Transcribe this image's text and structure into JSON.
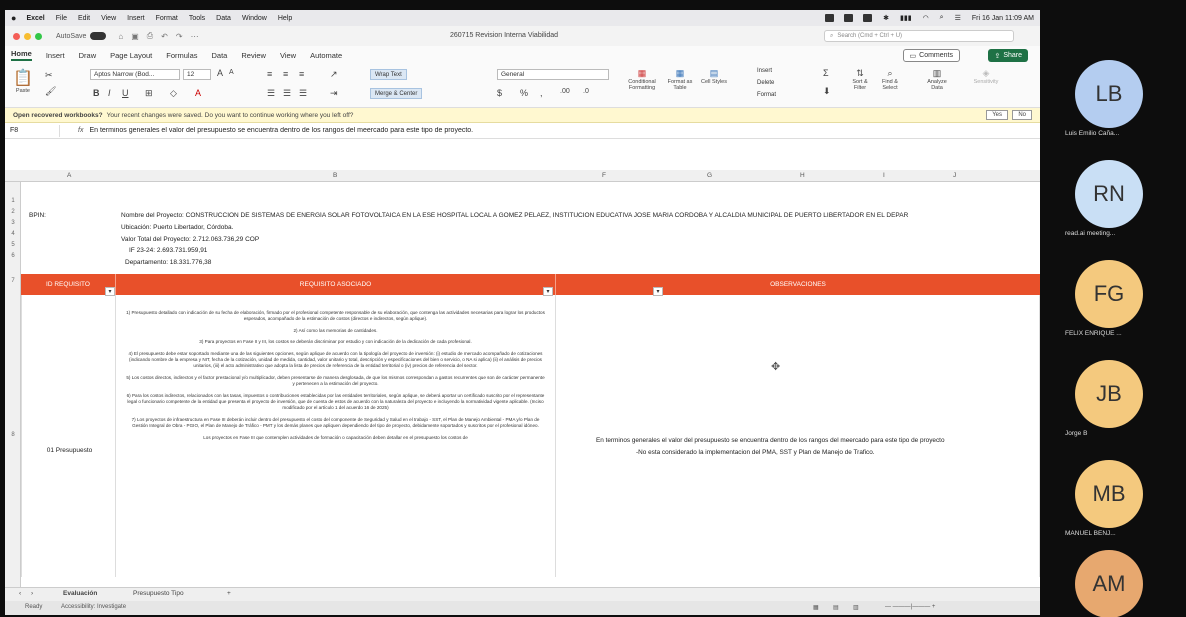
{
  "menubar": {
    "items": [
      "Excel",
      "File",
      "Edit",
      "View",
      "Insert",
      "Format",
      "Tools",
      "Data",
      "Window",
      "Help"
    ],
    "datetime": "Fri 16 Jan 11:09 AM"
  },
  "titlebar": {
    "autosave": "AutoSave",
    "title": "260715 Revision Interna Viabilidad",
    "search_placeholder": "Search (Cmd + Ctrl + U)"
  },
  "ribbon": {
    "tabs": [
      "Home",
      "Insert",
      "Draw",
      "Page Layout",
      "Formulas",
      "Data",
      "Review",
      "View",
      "Automate"
    ],
    "comments": "Comments",
    "share": "Share",
    "font_name": "Aptos Narrow (Bod...",
    "font_size": "12",
    "wrap_text": "Wrap Text",
    "merge_center": "Merge & Center",
    "number_format": "General",
    "paste": "Paste",
    "conditional_formatting": "Conditional Formatting",
    "format_as_table": "Format as Table",
    "cell_styles": "Cell Styles",
    "insert": "Insert",
    "delete": "Delete",
    "format": "Format",
    "sort_filter": "Sort & Filter",
    "find_select": "Find & Select",
    "analyze_data": "Analyze Data",
    "sensitivity": "Sensitivity"
  },
  "notification": {
    "title": "Open recovered workbooks?",
    "message": "Your recent changes were saved. Do you want to continue working where you left off?",
    "yes": "Yes",
    "no": "No"
  },
  "formula_bar": {
    "cell": "F8",
    "fx": "fx",
    "content": "En terminos generales el valor del presupuesto se encuentra dentro de los rangos del meercado para este tipo de proyecto."
  },
  "columns": [
    "A",
    "B",
    "F",
    "G",
    "H",
    "I",
    "J"
  ],
  "rows": [
    "1",
    "2",
    "3",
    "4",
    "5",
    "6",
    "7",
    "8"
  ],
  "sheet": {
    "bpin_label": "BPIN:",
    "project_name": "Nombre del Proyecto: CONSTRUCCIÓN DE SISTEMAS DE ENERGÍA SOLAR FOTOVOLTAICA EN LA ESE HOSPITAL LOCAL A GOMEZ PELAEZ, INSTITUCION EDUCATIVA JOSE MARIA CORDOBA Y ALCALDIA MUNICIPAL DE PUERTO LIBERTADOR EN EL DEPAR",
    "location": "Ubicación: Puerto Libertador, Córdoba.",
    "total_value": "Valor Total del Proyecto: 2.712.063.736,29 COP",
    "if_value": "IF 23-24: 2.693.731.959,91",
    "department_value": "Departamento: 18.331.776,38",
    "headers": {
      "id": "ID REQUISITO",
      "req": "REQUISITO ASOCIADO",
      "obs": "OBSERVACIONES"
    },
    "requirement_id": "01 Presupuesto",
    "requirement_paragraphs": [
      "1) Presupuesto detallado con indicación de su fecha de elaboración, firmado por el profesional competente responsable de su elaboración, que contenga las actividades necesarias para lograr los productos esperados, acompañado de la estimación de costos (directos e indirectos, según aplique).",
      "2) Así como las memorias de cantidades.",
      "3) Para proyectos en Fase II y III, los costos se deberán discriminar por estudio y con indicación de la dedicación de cada profesional.",
      "4) El presupuesto debe estar soportado mediante una de las siguientes opciones, según aplique de acuerdo con la tipología del proyecto de inversión: (i) estudio de mercado acompañado de cotizaciones (indicando nombre de la empresa y NIT, fecha de la cotización, unidad de medida, cantidad, valor unitario y total, descripción y especificaciones del bien o servicio, o NA si aplica) (ii) el análisis de precios unitarios, (iii) el acto administrativo que adopta la lista de precios de referencia de la entidad territorial o (iv) precios de referencia del sector.",
      "5) Los costos directos, indirectos y el factor prestacional y/o multiplicador, deben presentarse de manera desglosada, de que los mismos correspondan a gastos recurrentes que son de carácter permanente y pertenecen a la estimación del proyecto.",
      "6) Para los costos indirectos, relacionados con las tasas, impuestos o contribuciones establecidas por las entidades territoriales, según aplique, se deberá aportar un certificado suscrito por el representante legal o funcionario competente de la entidad que presenta el proyecto de inversión, que de cuenta de estos de acuerdo con la naturaleza del proyecto e incluyendo la normatividad vigente aplicable. (Inciso modificado por el artículo 1 del acuerdo 16 de 2025)",
      "7) Los proyectos de infraestructura en Fase III deberán incluir dentro del presupuesto el costo del componente de Seguridad y Salud en el trabajo - SST, el Plan de Manejo Ambiental - PMA y/o Plan de Gestión Integral de Obra - PGIO, el Plan de Manejo de Tráfico - PMT y los demás planes que apliquen dependiendo del tipo de proyecto, debidamente soportados y suscritos por el profesional idóneo.",
      "Los proyectos en Fase III que contemplen actividades de formación o capacitación deben detallar en el presupuesto los costos de"
    ],
    "observation_line1": "En terminos generales el valor del presupuesto se encuentra dentro de los rangos del meercado para este tipo de proyecto",
    "observation_line2": "-No esta considerado la implementacion del PMA, SST y Plan de Manejo de Trafico."
  },
  "sheet_tabs": [
    "Evaluación",
    "Presupuesto Tipo"
  ],
  "status": {
    "ready": "Ready",
    "accessibility": "Accessibility: Investigate"
  },
  "participants": [
    {
      "initials": "LB",
      "name": "Luis Emilio Caña...",
      "color": "#b4cdf0"
    },
    {
      "initials": "RN",
      "name": "read.ai meeting...",
      "color": "#c9dff5"
    },
    {
      "initials": "FG",
      "name": "FELIX ENRIQUE ...",
      "color": "#f4c97e"
    },
    {
      "initials": "JB",
      "name": "Jorge B",
      "color": "#f4c97e"
    },
    {
      "initials": "MB",
      "name": "MANUEL BENJ...",
      "color": "#f4c97e"
    },
    {
      "initials": "AM",
      "name": "",
      "color": "#e7a86f"
    }
  ]
}
